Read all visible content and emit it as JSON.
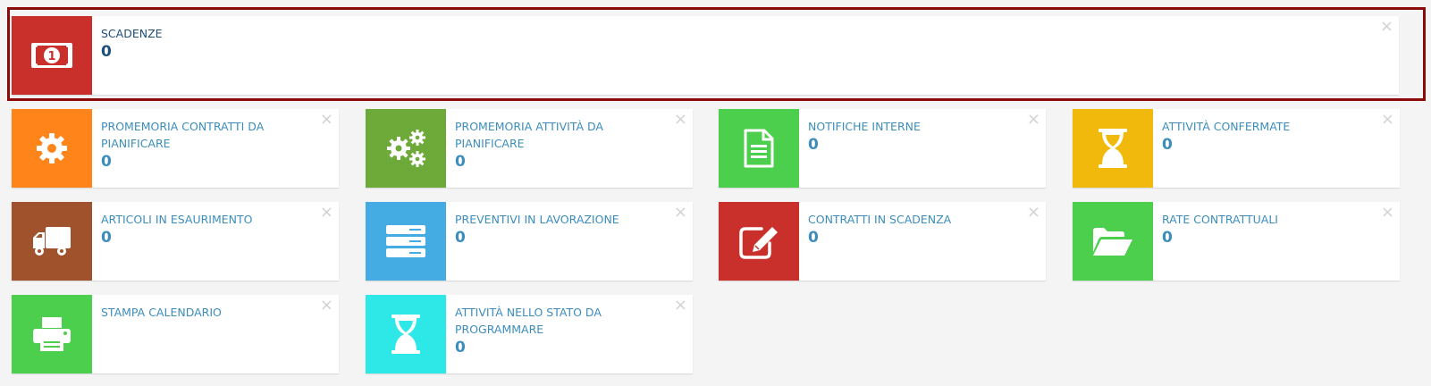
{
  "widgets": [
    {
      "label": "SCADENZE",
      "value": "0",
      "icon": "money-icon",
      "color": "#c9302c"
    },
    {
      "label": "PROMEMORIA CONTRATTI DA PIANIFICARE",
      "value": "0",
      "icon": "cog-icon",
      "color": "#ff851b"
    },
    {
      "label": "PROMEMORIA ATTIVITÀ DA PIANIFICARE",
      "value": "0",
      "icon": "cogs-icon",
      "color": "#6daa3a"
    },
    {
      "label": "NOTIFICHE INTERNE",
      "value": "0",
      "icon": "document-icon",
      "color": "#4ccf4c"
    },
    {
      "label": "ATTIVITÀ CONFERMATE",
      "value": "0",
      "icon": "hourglass-icon",
      "color": "#f0b90b"
    },
    {
      "label": "ARTICOLI IN ESAURIMENTO",
      "value": "0",
      "icon": "truck-icon",
      "color": "#a0522d"
    },
    {
      "label": "PREVENTIVI IN LAVORAZIONE",
      "value": "0",
      "icon": "server-icon",
      "color": "#45ace3"
    },
    {
      "label": "CONTRATTI IN SCADENZA",
      "value": "0",
      "icon": "edit-icon",
      "color": "#c9302c"
    },
    {
      "label": "RATE CONTRATTUALI",
      "value": "0",
      "icon": "folder-open-icon",
      "color": "#4ccf4c"
    },
    {
      "label": "STAMPA CALENDARIO",
      "value": "",
      "icon": "print-icon",
      "color": "#4ccf4c"
    },
    {
      "label": "ATTIVITÀ NELLO STATO DA PROGRAMMARE",
      "value": "0",
      "icon": "hourglass-icon",
      "color": "#2ee8e8"
    }
  ],
  "close_glyph": "×"
}
